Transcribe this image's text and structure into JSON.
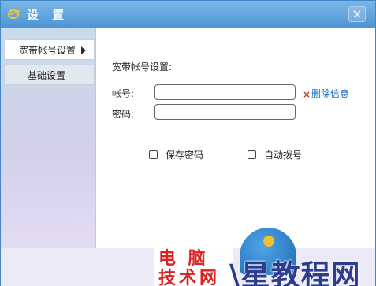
{
  "window": {
    "title": "设 置"
  },
  "titlebar": {
    "close_label": "×"
  },
  "sidebar": {
    "items": [
      {
        "label": "宽带帐号设置",
        "active": true
      },
      {
        "label": "基础设置",
        "active": false
      }
    ]
  },
  "broadband": {
    "section_title": "宽带帐号设置:",
    "account_label": "帐号:",
    "account_value": "",
    "password_label": "密码:",
    "password_value": "",
    "delete_mark": "×",
    "delete_link": "删除信息"
  },
  "options": {
    "save_password": {
      "label": "保存密码",
      "checked": false
    },
    "auto_dial": {
      "label": "自动拨号",
      "checked": false
    }
  },
  "watermark": {
    "line1": "电 脑",
    "line2": "技术网",
    "right": "\\星教程网"
  },
  "colors": {
    "titlebar": "#5aa1db",
    "link": "#1d6fbf",
    "delete_mark": "#c0392b",
    "watermark_red": "#e02020",
    "watermark_blue": "#2b3d8c"
  }
}
